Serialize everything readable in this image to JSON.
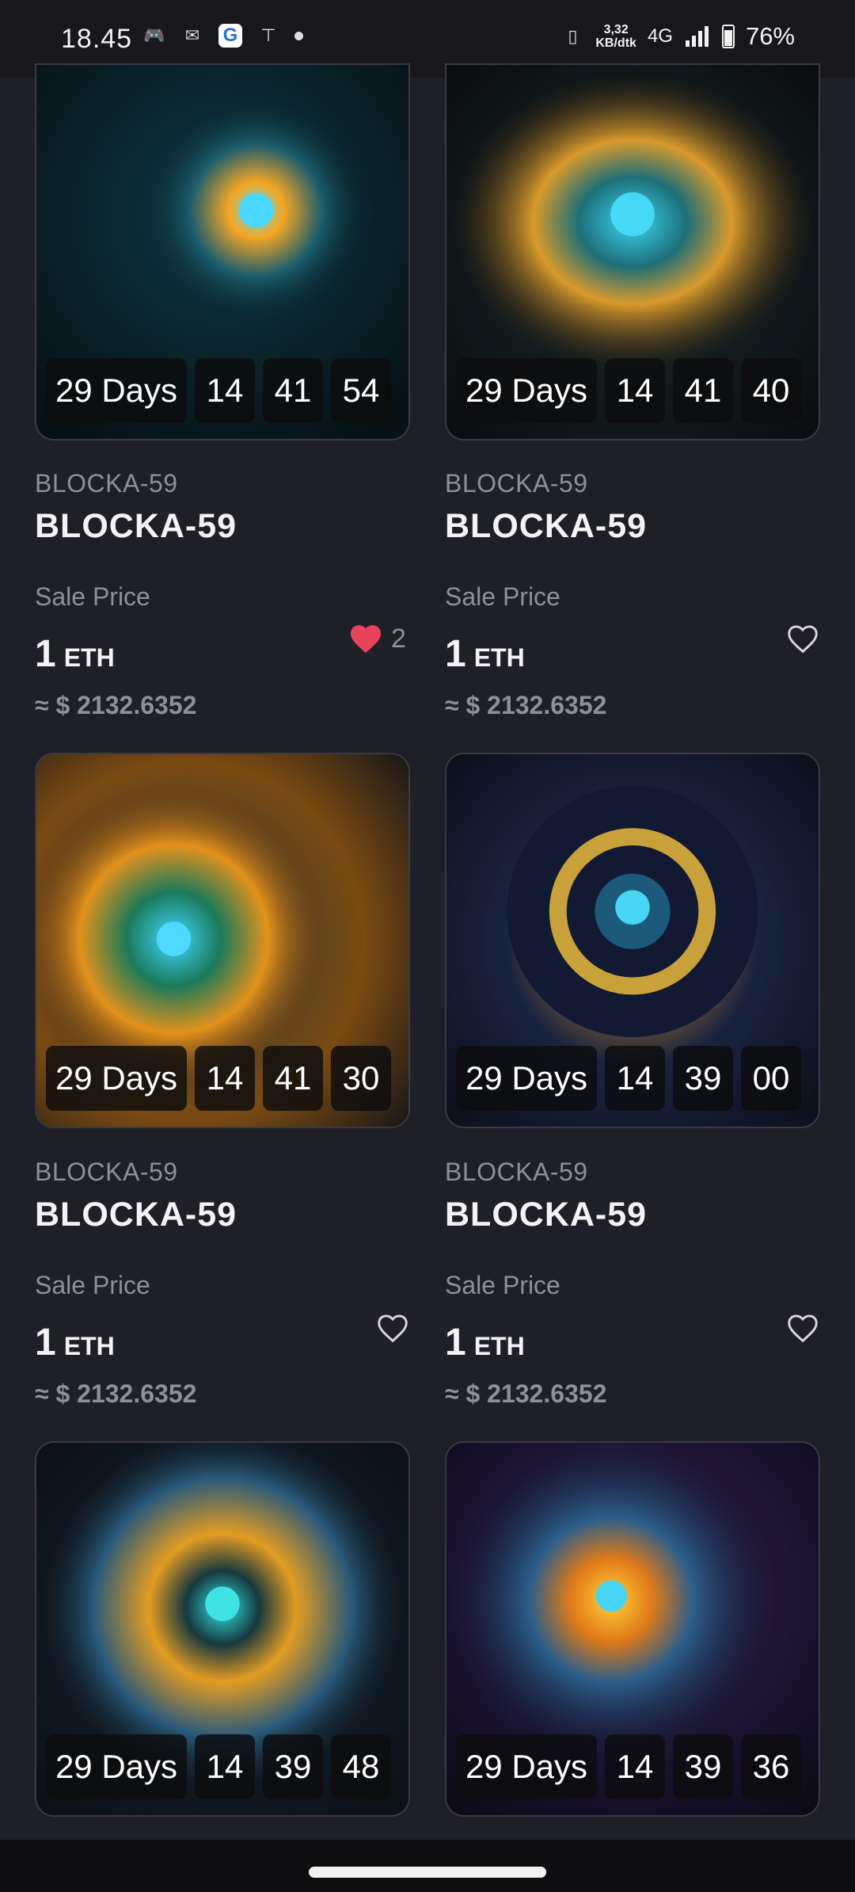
{
  "status_bar": {
    "time": "18.45",
    "speed_top": "3,32",
    "speed_bottom": "KB/dtk",
    "network": "4G",
    "battery": "76%"
  },
  "cards": [
    {
      "collection": "BLOCKA-59",
      "title": "BLOCKA-59",
      "sale_label": "Sale Price",
      "price": "1",
      "unit": "ETH",
      "usd": "≈ $ 2132.6352",
      "timer": {
        "days": "29 Days",
        "h": "14",
        "m": "41",
        "s": "54"
      },
      "liked": true,
      "likes": "2"
    },
    {
      "collection": "BLOCKA-59",
      "title": "BLOCKA-59",
      "sale_label": "Sale Price",
      "price": "1",
      "unit": "ETH",
      "usd": "≈ $ 2132.6352",
      "timer": {
        "days": "29 Days",
        "h": "14",
        "m": "41",
        "s": "40"
      },
      "liked": false,
      "likes": ""
    },
    {
      "collection": "BLOCKA-59",
      "title": "BLOCKA-59",
      "sale_label": "Sale Price",
      "price": "1",
      "unit": "ETH",
      "usd": "≈ $ 2132.6352",
      "timer": {
        "days": "29 Days",
        "h": "14",
        "m": "41",
        "s": "30"
      },
      "liked": false,
      "likes": ""
    },
    {
      "collection": "BLOCKA-59",
      "title": "BLOCKA-59",
      "sale_label": "Sale Price",
      "price": "1",
      "unit": "ETH",
      "usd": "≈ $ 2132.6352",
      "timer": {
        "days": "29 Days",
        "h": "14",
        "m": "39",
        "s": "00"
      },
      "liked": false,
      "likes": ""
    },
    {
      "timer": {
        "days": "29 Days",
        "h": "14",
        "m": "39",
        "s": "48"
      }
    },
    {
      "timer": {
        "days": "29 Days",
        "h": "14",
        "m": "39",
        "s": "36"
      }
    }
  ],
  "colors": {
    "background": "#1f1f27",
    "heart_active": "#e8435a",
    "muted": "#8e8f98"
  }
}
